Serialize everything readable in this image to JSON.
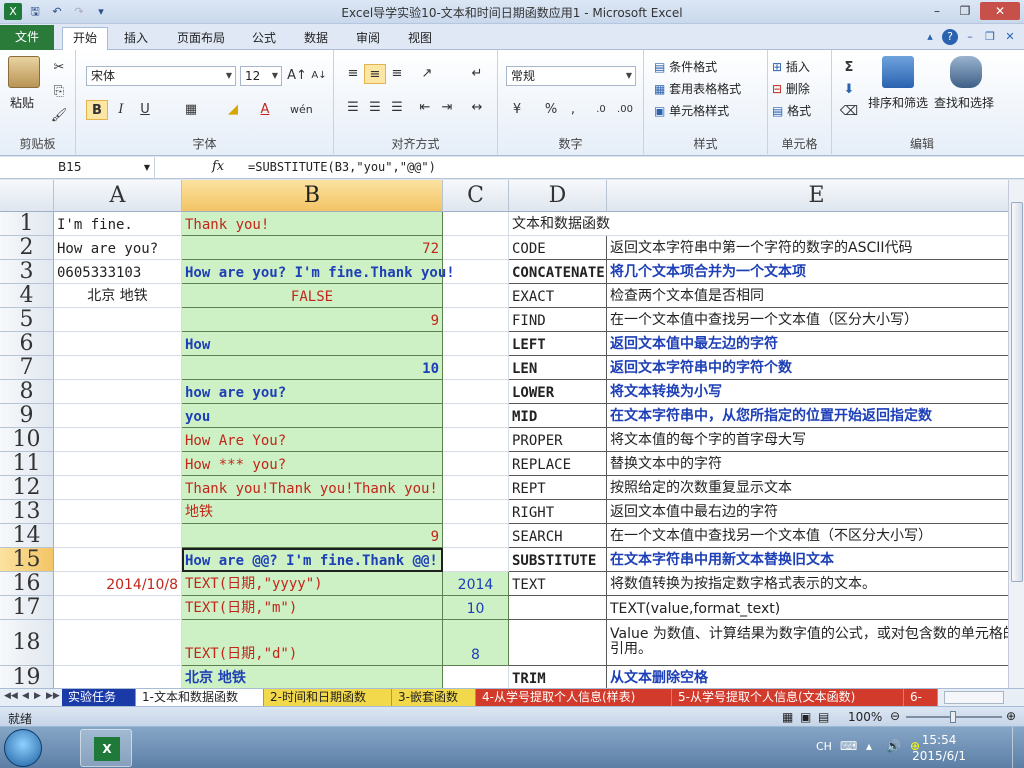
{
  "window": {
    "title": "Excel导学实验10-文本和时间日期函数应用1  -  Microsoft Excel"
  },
  "ribbon": {
    "file_tab": "文件",
    "tabs": [
      "开始",
      "插入",
      "页面布局",
      "公式",
      "数据",
      "审阅",
      "视图"
    ],
    "active_tab": "开始",
    "clipboard": {
      "paste": "粘贴",
      "group": "剪贴板"
    },
    "font": {
      "name": "宋体",
      "size": "12",
      "group": "字体"
    },
    "alignment": {
      "group": "对齐方式"
    },
    "number": {
      "format": "常规",
      "group": "数字"
    },
    "styles": {
      "conditional": "条件格式",
      "table": "套用表格格式",
      "cell": "单元格样式",
      "group": "样式"
    },
    "cells": {
      "insert": "插入",
      "delete": "删除",
      "format": "格式",
      "group": "单元格"
    },
    "editing": {
      "sort": "排序和筛选",
      "find": "查找和选择",
      "group": "编辑"
    }
  },
  "formula_bar": {
    "cell_ref": "B15",
    "fx": "fx",
    "formula": "=SUBSTITUTE(B3,\"you\",\"@@\")"
  },
  "grid": {
    "columns": [
      "A",
      "B",
      "C",
      "D",
      "E"
    ],
    "rows": [
      {
        "n": "1",
        "a": "I'm fine.",
        "b": "Thank you!",
        "c": "",
        "d": "文本和数据函数",
        "e": ""
      },
      {
        "n": "2",
        "a": "How are you?",
        "b": "72",
        "c": "",
        "d": "CODE",
        "e": "返回文本字符串中第一个字符的数字的ASCII代码"
      },
      {
        "n": "3",
        "a": "0605333103",
        "b": "How are you? I'm fine.Thank you!",
        "c": "",
        "d": "CONCATENATE",
        "e": "将几个文本项合并为一个文本项"
      },
      {
        "n": "4",
        "a": "北京  地铁",
        "b": "FALSE",
        "c": "",
        "d": "EXACT",
        "e": "检查两个文本值是否相同"
      },
      {
        "n": "5",
        "a": "",
        "b": "9",
        "c": "",
        "d": "FIND",
        "e": "在一个文本值中查找另一个文本值（区分大小写）"
      },
      {
        "n": "6",
        "a": "",
        "b": "How",
        "c": "",
        "d": "LEFT",
        "e": "返回文本值中最左边的字符"
      },
      {
        "n": "7",
        "a": "",
        "b": "10",
        "c": "",
        "d": "LEN",
        "e": "返回文本字符串中的字符个数"
      },
      {
        "n": "8",
        "a": "",
        "b": "how are you?",
        "c": "",
        "d": "LOWER",
        "e": "将文本转换为小写"
      },
      {
        "n": "9",
        "a": "",
        "b": "you",
        "c": "",
        "d": "MID",
        "e": "在文本字符串中，从您所指定的位置开始返回指定数"
      },
      {
        "n": "10",
        "a": "",
        "b": "How Are You?",
        "c": "",
        "d": "PROPER",
        "e": "将文本值的每个字的首字母大写"
      },
      {
        "n": "11",
        "a": "",
        "b": "How *** you?",
        "c": "",
        "d": "REPLACE",
        "e": "替换文本中的字符"
      },
      {
        "n": "12",
        "a": "",
        "b": "Thank you!Thank you!Thank you!",
        "c": "",
        "d": "REPT",
        "e": "按照给定的次数重复显示文本"
      },
      {
        "n": "13",
        "a": "",
        "b": "地铁",
        "c": "",
        "d": "RIGHT",
        "e": "返回文本值中最右边的字符"
      },
      {
        "n": "14",
        "a": "",
        "b": "9",
        "c": "",
        "d": "SEARCH",
        "e": "在一个文本值中查找另一个文本值（不区分大小写）"
      },
      {
        "n": "15",
        "a": "",
        "b": "How are @@? I'm fine.Thank @@!",
        "c": "",
        "d": "SUBSTITUTE",
        "e": "在文本字符串中用新文本替换旧文本"
      },
      {
        "n": "16",
        "a": "2014/10/8",
        "b": "TEXT(日期,\"yyyy\")",
        "c": "2014",
        "d": "TEXT",
        "e": "将数值转换为按指定数字格式表示的文本。"
      },
      {
        "n": "17",
        "a": "",
        "b": "TEXT(日期,\"m\")",
        "c": "10",
        "d": "",
        "e": "TEXT(value,format_text)"
      },
      {
        "n": "18",
        "a": "",
        "b": "TEXT(日期,\"d\")",
        "c": "8",
        "d": "",
        "e": "Value     为数值、计算结果为数字值的公式，或对包含数的单元格的引用。"
      },
      {
        "n": "19",
        "a": "",
        "b": "北京 地铁",
        "c": "",
        "d": "TRIM",
        "e": "从文本删除空格"
      }
    ]
  },
  "sheet_tabs": [
    "实验任务",
    "1-文本和数据函数",
    "2-时间和日期函数",
    "3-嵌套函数",
    "4-从学号提取个人信息(样表)",
    "5-从学号提取个人信息(文本函数)",
    "6-"
  ],
  "status": {
    "ready": "就绪",
    "zoom": "100%"
  },
  "taskbar": {
    "ime": "CH",
    "time": "15:54",
    "date": "2015/6/1"
  }
}
